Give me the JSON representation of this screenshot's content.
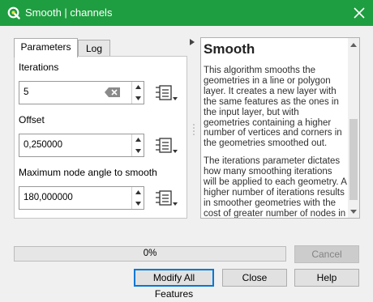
{
  "window": {
    "title": "Smooth | channels",
    "title_bar_color": "#1e9e40",
    "app_icon": "qgis-logo-icon",
    "close_icon": "close-icon"
  },
  "tabs": [
    {
      "label": "Parameters",
      "active": true
    },
    {
      "label": "Log",
      "active": false
    }
  ],
  "parameters": {
    "iterations": {
      "label": "Iterations",
      "value": "5"
    },
    "offset": {
      "label": "Offset",
      "value": "0,250000"
    },
    "max_angle": {
      "label": "Maximum node angle to smooth",
      "value": "180,000000"
    }
  },
  "help": {
    "title": "Smooth",
    "paragraphs": [
      "This algorithm smooths the geometries in a line or polygon layer. It creates a new layer with the same features as the ones in the input layer, but with geometries containing a higher number of vertices and corners in the geometries smoothed out.",
      "The iterations parameter dictates how many smoothing iterations will be applied to each geometry. A higher number of iterations results in smoother geometries with the cost of greater number of nodes in the geometries."
    ]
  },
  "progress": {
    "text": "0%",
    "value": 0,
    "fill_color": "#06b025"
  },
  "buttons": {
    "cancel": "Cancel",
    "modify": "Modify All Features",
    "close": "Close",
    "help": "Help"
  }
}
